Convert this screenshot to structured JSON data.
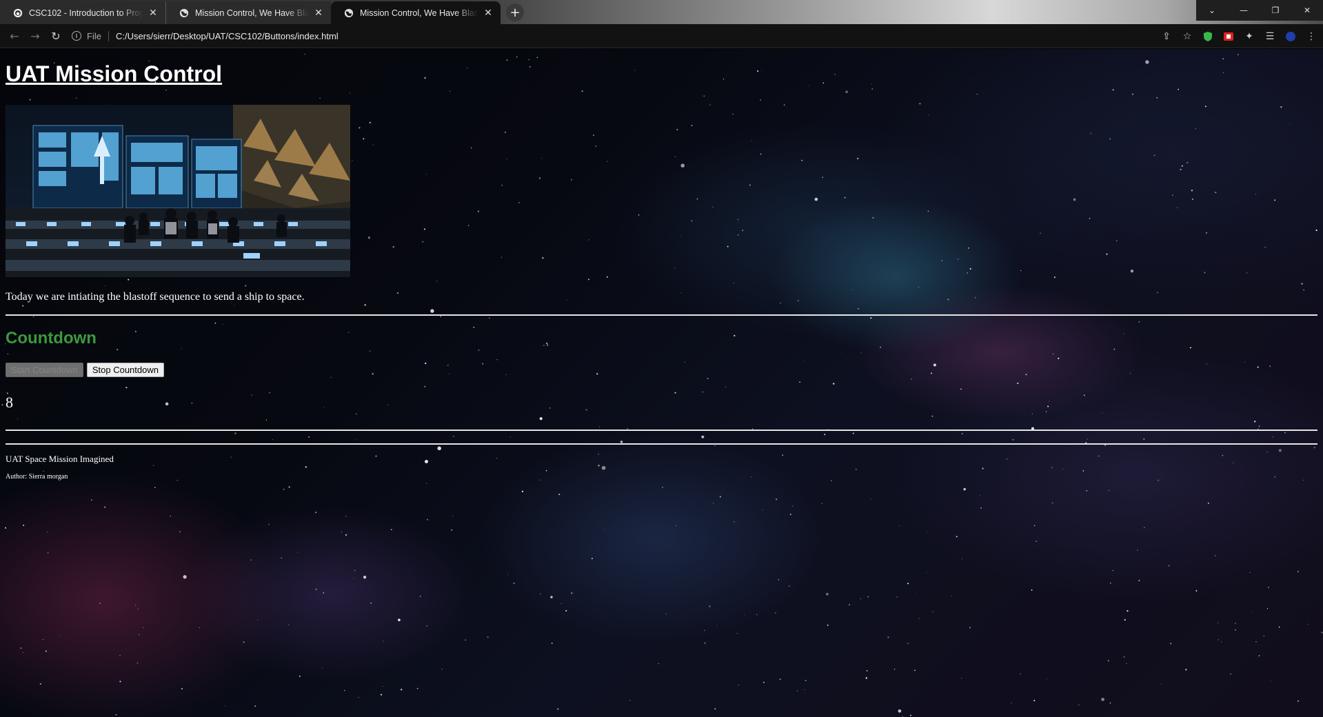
{
  "browser": {
    "tabs": [
      {
        "title": "CSC102 - Introduction to Programming",
        "favicon": "github-icon"
      },
      {
        "title": "Mission Control, We Have Blastoff",
        "favicon": "globe-icon"
      },
      {
        "title": "Mission Control, We Have Blastoff",
        "favicon": "globe-icon",
        "active": true
      }
    ],
    "address": {
      "scheme": "File",
      "url": "C:/Users/sierr/Desktop/UAT/CSC102/Buttons/index.html"
    }
  },
  "page": {
    "title": "UAT Mission Control",
    "intro": "Today we are intiating the blastoff sequence to send a ship to space.",
    "countdown_heading": "Countdown",
    "start_button": "Start Countdown",
    "stop_button": "Stop Countdown",
    "count_value": "8",
    "footer_line1": "UAT Space Mission Imagined",
    "footer_line2": "Author: Sierra morgan"
  },
  "colors": {
    "heading_green": "#3b9a3b",
    "text": "#ffffff",
    "rule": "#e6e6e6"
  }
}
